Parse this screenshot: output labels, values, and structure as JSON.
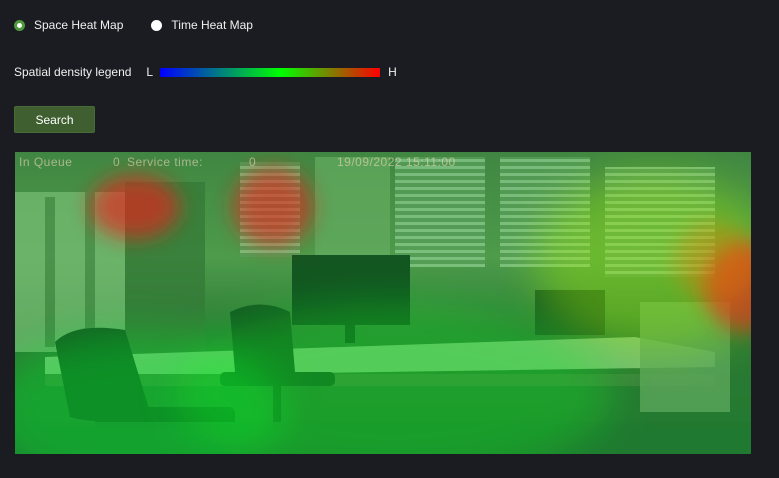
{
  "mode_selector": {
    "space_label": "Space Heat Map",
    "time_label": "Time Heat Map",
    "selected": "Space Heat Map"
  },
  "legend": {
    "label": "Spatial density legend",
    "low_label": "L",
    "high_label": "H"
  },
  "search": {
    "label": "Search"
  },
  "heatmap": {
    "osd_queue": "In Queue",
    "osd_queue_value": "0",
    "osd_service_label": "Service time:",
    "osd_service_value": "0",
    "osd_timestamp": "19/09/2022 15:11:00"
  },
  "colors": {
    "background": "#1a1c22",
    "accent": "#4f9a3c",
    "button": "#3f5f30",
    "legend_low": "#0000ff",
    "legend_mid": "#00ff00",
    "legend_high": "#ff0000"
  }
}
